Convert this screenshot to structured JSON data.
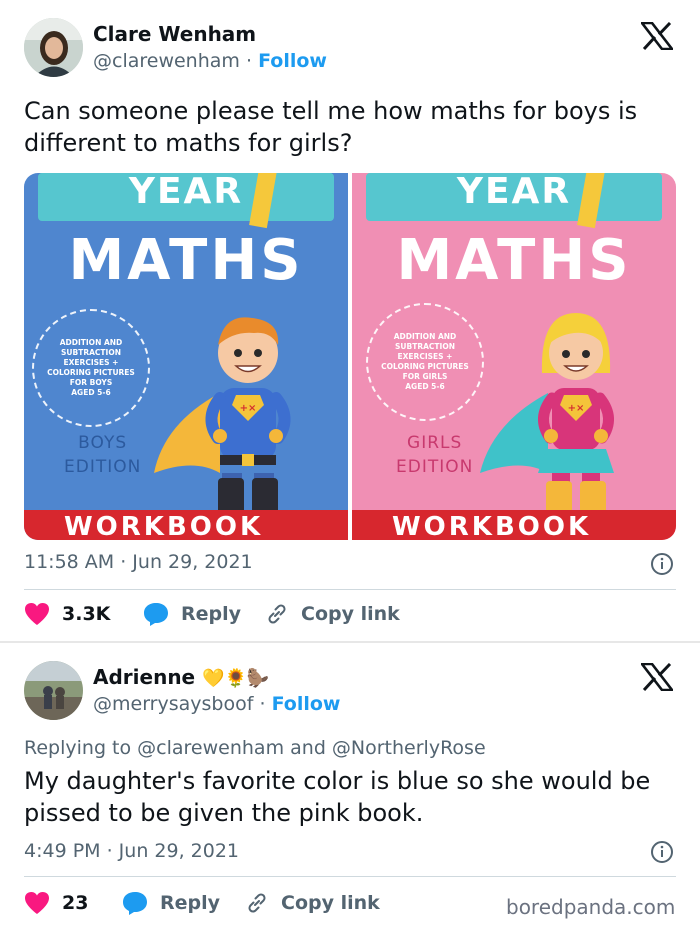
{
  "tweet1": {
    "author_name": "Clare Wenham",
    "handle": "@clarewenham",
    "separator": "·",
    "follow_label": "Follow",
    "text": "Can someone please tell me how maths for boys is different to maths for girls?",
    "timestamp": "11:58 AM · Jun 29, 2021",
    "likes": "3.3K",
    "reply_label": "Reply",
    "copy_link_label": "Copy link",
    "books": [
      {
        "year": "YEAR",
        "maths": "MATHS",
        "badge_lines": [
          "ADDITION AND",
          "SUBTRACTION",
          "EXERCISES +",
          "COLORING PICTURES",
          "FOR BOYS",
          "AGED 5-6"
        ],
        "edition_line1": "BOYS",
        "edition_line2": "EDITION",
        "workbook": "WORKBOOK",
        "bg_color": "#4f86cf",
        "edition_color": "#2c5a9e"
      },
      {
        "year": "YEAR",
        "maths": "MATHS",
        "badge_lines": [
          "ADDITION AND",
          "SUBTRACTION",
          "EXERCISES +",
          "COLORING PICTURES",
          "FOR GIRLS",
          "AGED 5-6"
        ],
        "edition_line1": "GIRLS",
        "edition_line2": "EDITION",
        "workbook": "WORKBOOK",
        "bg_color": "#f08fb4",
        "edition_color": "#c8396e"
      }
    ]
  },
  "tweet2": {
    "author_name": "Adrienne",
    "emojis": "💛🌻🦫",
    "handle": "@merrysaysboof",
    "separator": "·",
    "follow_label": "Follow",
    "replying_prefix": "Replying to",
    "replying_users": "@clarewenham and @NortherlyRose",
    "text": "My daughter's favorite color is blue so she would be pissed to be given the pink book.",
    "timestamp": "4:49 PM · Jun 29, 2021",
    "likes": "23",
    "reply_label": "Reply",
    "copy_link_label": "Copy link"
  },
  "watermark": "boredpanda.com",
  "colors": {
    "accent": "#1d9bf0",
    "like_red": "#f91880",
    "text_dark": "#0f1419",
    "text_muted": "#536471"
  },
  "icons": [
    "x-logo-icon",
    "heart-icon",
    "reply-bubble-icon",
    "link-icon",
    "info-icon"
  ]
}
